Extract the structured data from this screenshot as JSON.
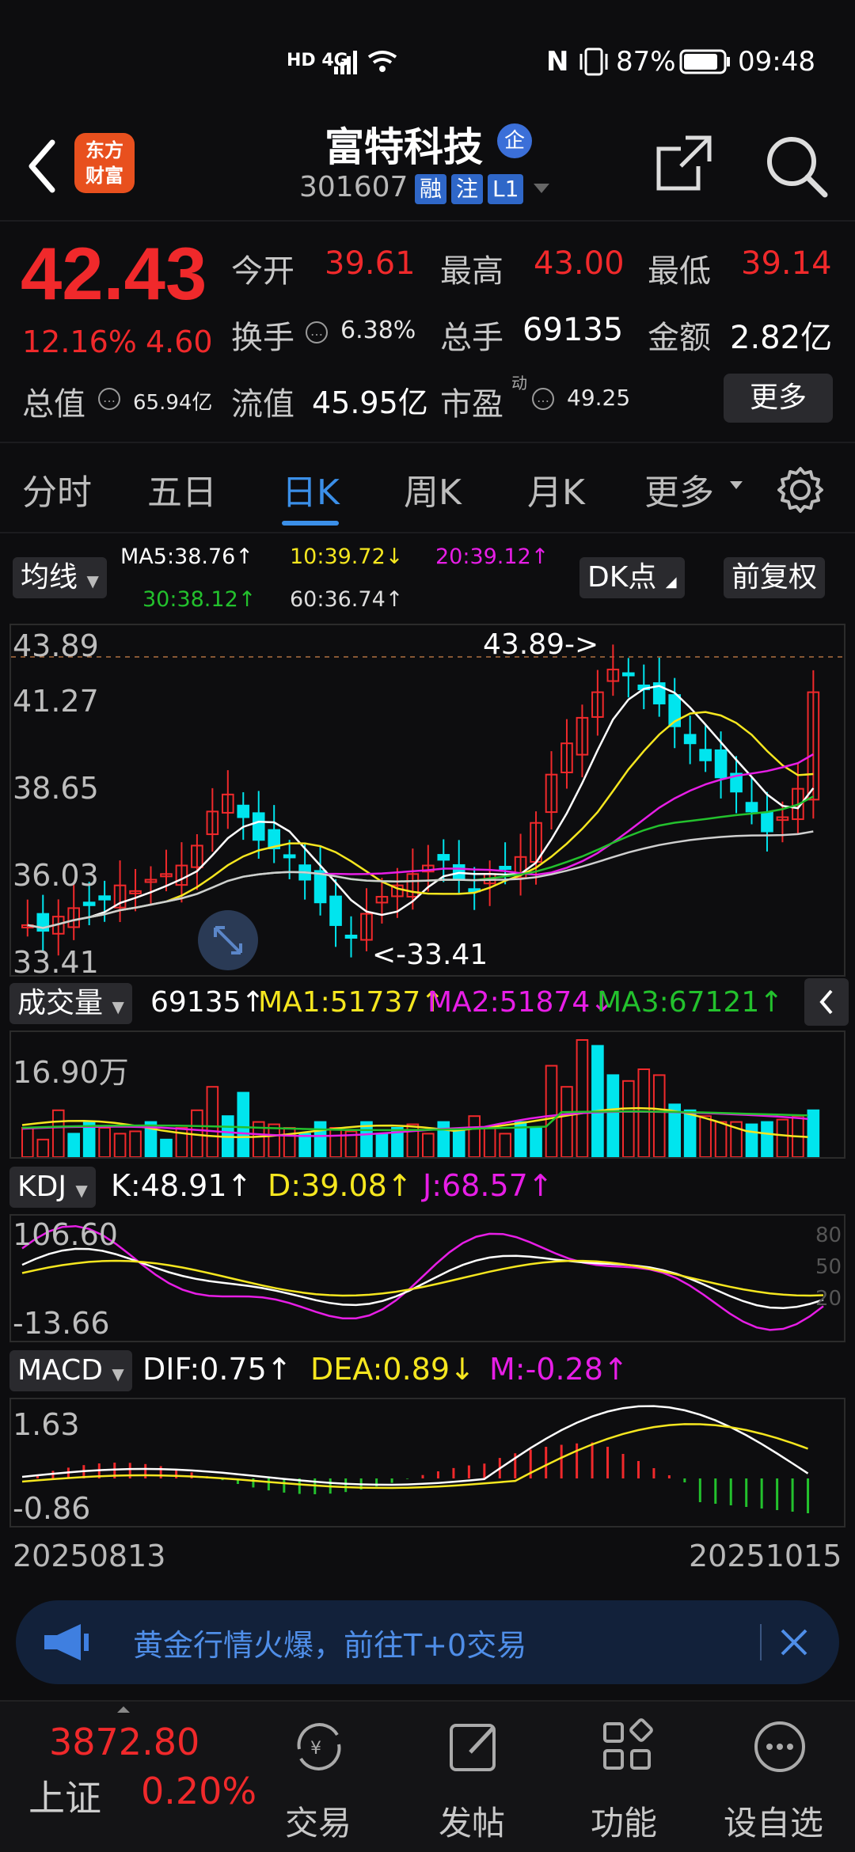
{
  "status_bar": {
    "network": "HD 4G",
    "nfc": "N",
    "battery": "87%",
    "time": "09:48"
  },
  "header": {
    "logo_text_line1": "东方",
    "logo_text_line2": "财富",
    "stock_name": "富特科技",
    "qi_badge": "企",
    "stock_code": "301607",
    "tags": [
      "融",
      "注",
      "L1"
    ]
  },
  "quote": {
    "price": "42.43",
    "change_pct": "12.16%",
    "change": "4.60",
    "open_label": "今开",
    "open": "39.61",
    "high_label": "最高",
    "high": "43.00",
    "low_label": "最低",
    "low": "39.14",
    "turnover_label": "换手",
    "turnover": "6.38%",
    "volume_label": "总手",
    "volume": "69135",
    "amount_label": "金额",
    "amount": "2.82亿",
    "mktcap_label": "总值",
    "mktcap": "65.94亿",
    "float_label": "流值",
    "float_cap": "45.95亿",
    "pe_label": "市盈",
    "pe_sup": "动",
    "pe": "49.25",
    "more": "更多"
  },
  "tabs": [
    "分时",
    "五日",
    "日K",
    "周K",
    "月K",
    "更多"
  ],
  "active_tab": 2,
  "kline_bar": {
    "mode": "均线",
    "ma5": "MA5:38.76↑",
    "ma10": "10:39.72↓",
    "ma20": "20:39.12↑",
    "ma30": "30:38.12↑",
    "ma60": "60:36.74↑",
    "dk": "DK点",
    "adjust": "前复权"
  },
  "kline": {
    "y_labels": [
      "43.89",
      "41.27",
      "38.65",
      "36.03",
      "33.41"
    ],
    "max_marker": "43.89->",
    "min_marker": "<-33.41"
  },
  "volume_bar": {
    "label": "成交量",
    "value": "69135↑",
    "ma1": "MA1:51737↑",
    "ma2": "MA2:51874↓",
    "ma3": "MA3:67121↑",
    "y_label": "16.90万"
  },
  "kdj_bar": {
    "label": "KDJ",
    "k": "K:48.91↑",
    "d": "D:39.08↑",
    "j": "J:68.57↑",
    "y_top": "106.60",
    "y_bottom": "-13.66",
    "levels": [
      "80",
      "50",
      "20"
    ]
  },
  "macd_bar": {
    "label": "MACD",
    "dif": "DIF:0.75↑",
    "dea": "DEA:0.89↓",
    "m": "M:-0.28↑",
    "y_top": "1.63",
    "y_bottom": "-0.86"
  },
  "dates": {
    "start": "20250813",
    "end": "20251015"
  },
  "banner": {
    "text": "黄金行情火爆，前往T+0交易"
  },
  "bottom_nav": {
    "index_value": "3872.80",
    "index_name": "上证",
    "index_change": "0.20%",
    "items": [
      "交易",
      "发帖",
      "功能",
      "设自选"
    ]
  },
  "colors": {
    "up": "#f0292b",
    "down": "#00e5ee",
    "accent": "#3b8fe8",
    "ma5": "#ffffff",
    "ma10": "#f5e61f",
    "ma20": "#e71ee6",
    "ma30": "#23c12d",
    "ma60": "#cfcfcf"
  }
}
